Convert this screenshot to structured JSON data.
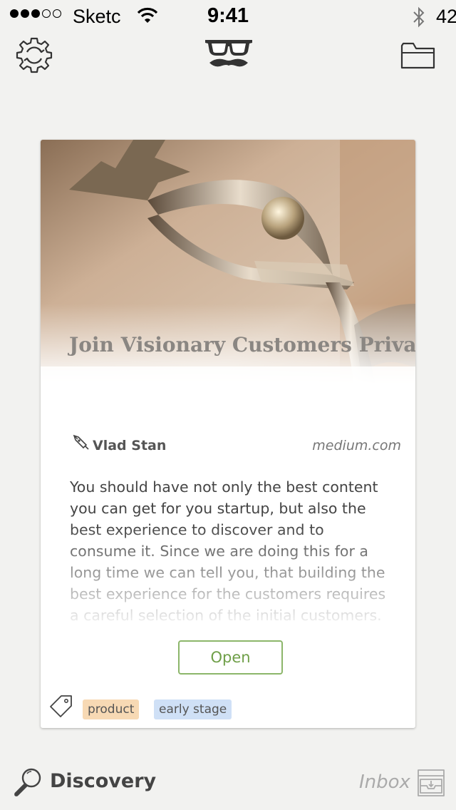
{
  "status_bar": {
    "carrier": "Sketc",
    "time": "9:41",
    "battery": "42"
  },
  "card": {
    "headline": "Join Visionary Customers Private Beta for Startupkit",
    "author": "Vlad Stan",
    "source": "medium.com",
    "excerpt": "You should have not only the best content you can get for you startup, but also the best experience to discover and to consume it. Since we are doing this for a long time we can tell you, that building the best experience for the customers requires a careful selection of the initial customers.",
    "open_label": "Open",
    "tags": [
      "product",
      "early stage"
    ]
  },
  "tab_bar": {
    "discovery_label": "Discovery",
    "inbox_label": "Inbox"
  },
  "icons": {
    "settings": "gear-icon",
    "logo": "glasses-mustache-icon",
    "folder": "folder-icon",
    "author": "pen-icon",
    "tag": "tag-icon",
    "discovery": "magnifier-icon",
    "inbox": "inbox-tray-icon"
  },
  "colors": {
    "accent_green": "#8cb66a",
    "tag_product": "#f7d9b4",
    "tag_early_stage": "#cfe0f6"
  }
}
